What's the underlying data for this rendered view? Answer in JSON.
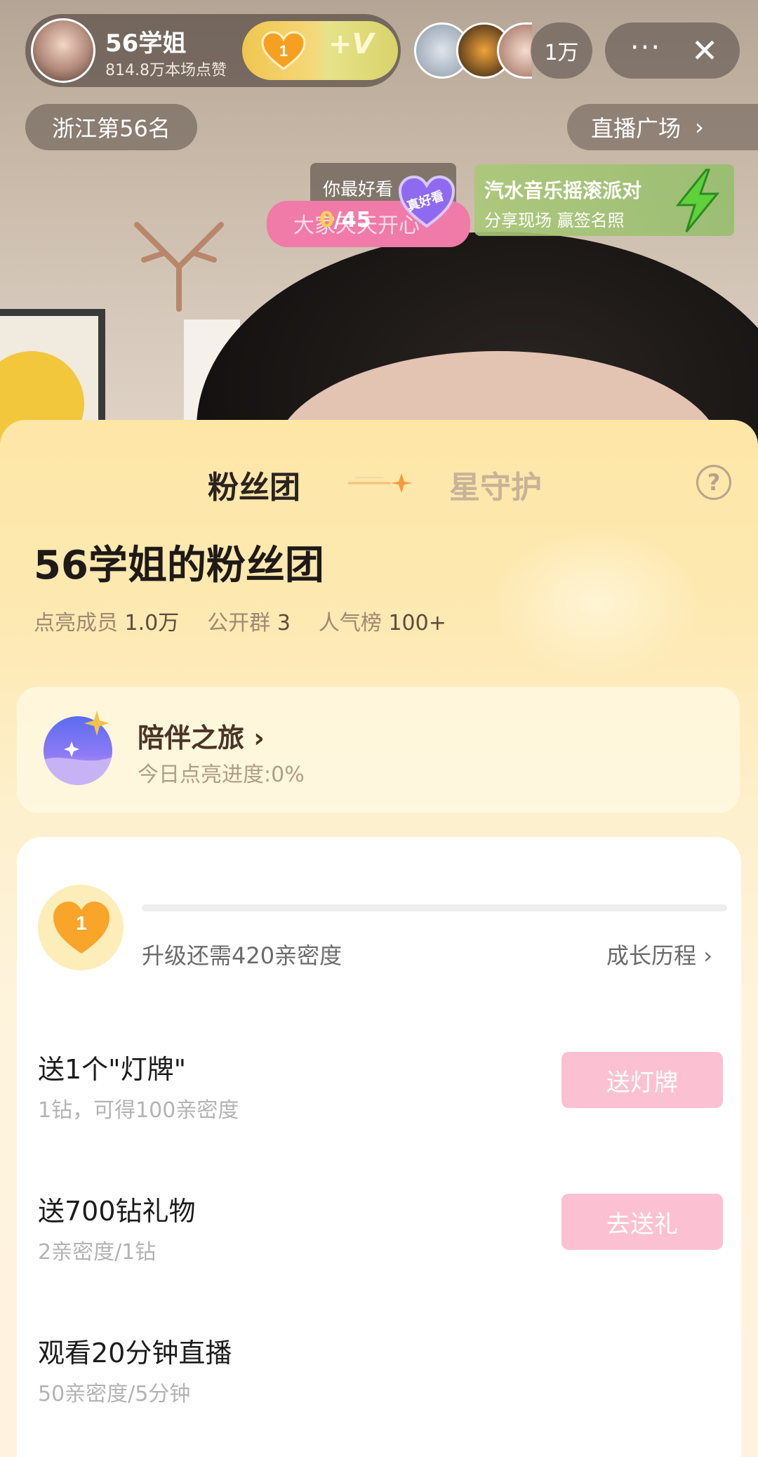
{
  "header": {
    "host_name": "56学姐",
    "host_likes": "814.8万本场点赞",
    "fan_badge_level": "1",
    "vip_label": "+V",
    "viewer_count": "1万",
    "more_label": "···",
    "close_label": "✕",
    "rank_label": "浙江第56名",
    "plaza_label": "直播广场",
    "plaza_chevron": "›"
  },
  "overlay": {
    "pretty_title": "你最好看",
    "pretty_banner": "大家天天开心",
    "pretty_count_current": "0",
    "pretty_count_total": "/45",
    "pretty_icon_label": "真好看",
    "party_title": "汽水音乐摇滚派对",
    "party_sub": "分享现场 赢签名照"
  },
  "panel": {
    "tabs": [
      {
        "label": "粉丝团",
        "active": true
      },
      {
        "label": "星守护",
        "active": false
      }
    ],
    "help_label": "?",
    "club_title": "56学姐的粉丝团",
    "stats": [
      {
        "label": "点亮成员",
        "value": "1.0万"
      },
      {
        "label": "公开群",
        "value": "3"
      },
      {
        "label": "人气榜",
        "value": "100+"
      }
    ],
    "journey": {
      "title": "陪伴之旅",
      "chevron": "›",
      "progress_text": "今日点亮进度:0%"
    },
    "level": {
      "value": "1",
      "progress": 0,
      "upgrade_text": "升级还需420亲密度",
      "growth_link": "成长历程",
      "growth_chevron": "›"
    },
    "tasks": [
      {
        "title": "送1个\"灯牌\"",
        "sub": "1钻，可得100亲密度",
        "button": "送灯牌"
      },
      {
        "title": "送700钻礼物",
        "sub": "2亲密度/1钻",
        "button": "去送礼"
      },
      {
        "title": "观看20分钟直播",
        "sub": "50亲密度/5分钟",
        "button": ""
      }
    ]
  },
  "colors": {
    "accent_gold": "#f5b74b",
    "button_pink": "#fbc1d2",
    "panel_bg": "#fde6a6"
  }
}
